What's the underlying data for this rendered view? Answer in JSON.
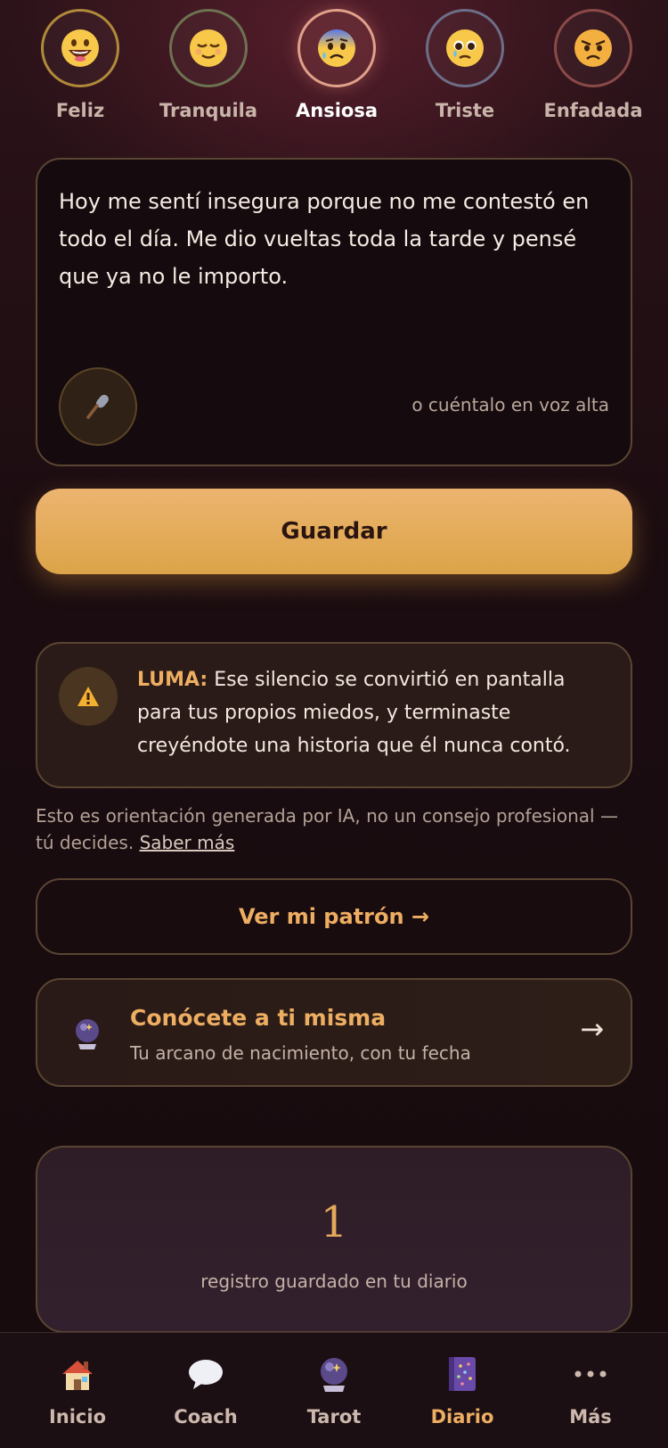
{
  "moods": [
    {
      "label": "Feliz",
      "icon": "grinning-face-icon",
      "ring_color": "#b08a3a"
    },
    {
      "label": "Tranquila",
      "icon": "relieved-face-icon",
      "ring_color": "#6d7252"
    },
    {
      "label": "Ansiosa",
      "icon": "anxious-face-icon",
      "ring_color": "#e0a08a",
      "selected": true
    },
    {
      "label": "Triste",
      "icon": "pleading-face-icon",
      "ring_color": "#6d6e86"
    },
    {
      "label": "Enfadada",
      "icon": "angry-face-icon",
      "ring_color": "#8a4a48"
    }
  ],
  "entry": {
    "text": "Hoy me sentí insegura porque no me contestó en todo el día. Me dio vueltas toda la tarde y pensé que ya no le importo.",
    "voice_hint": "o cuéntalo en voz alta",
    "mic_icon": "microphone-icon"
  },
  "save_button": "Guardar",
  "luma": {
    "label": "LUMA:",
    "message": "Ese silencio se convirtió en pantalla para tus propios miedos, y terminaste creyéndote una historia que él nunca contó.",
    "icon": "warning-icon"
  },
  "disclaimer": {
    "text": "Esto es orientación generada por IA, no un consejo profesional — tú decides.",
    "link": "Saber más"
  },
  "pattern_button": "Ver mi patrón →",
  "know_card": {
    "title": "Conócete a ti misma",
    "subtitle": "Tu arcano de nacimiento, con tu fecha",
    "arrow": "→",
    "icon": "crystal-ball-icon"
  },
  "stats": {
    "count": "1",
    "label": "registro guardado en tu diario"
  },
  "nav": [
    {
      "label": "Inicio",
      "icon": "house-icon"
    },
    {
      "label": "Coach",
      "icon": "speech-bubble-icon"
    },
    {
      "label": "Tarot",
      "icon": "crystal-ball-icon"
    },
    {
      "label": "Diario",
      "icon": "journal-icon",
      "active": true
    },
    {
      "label": "Más",
      "icon": "more-dots-icon"
    }
  ],
  "colors": {
    "accent": "#eeae62",
    "button": "#dca447",
    "background": "#1a0c10"
  }
}
